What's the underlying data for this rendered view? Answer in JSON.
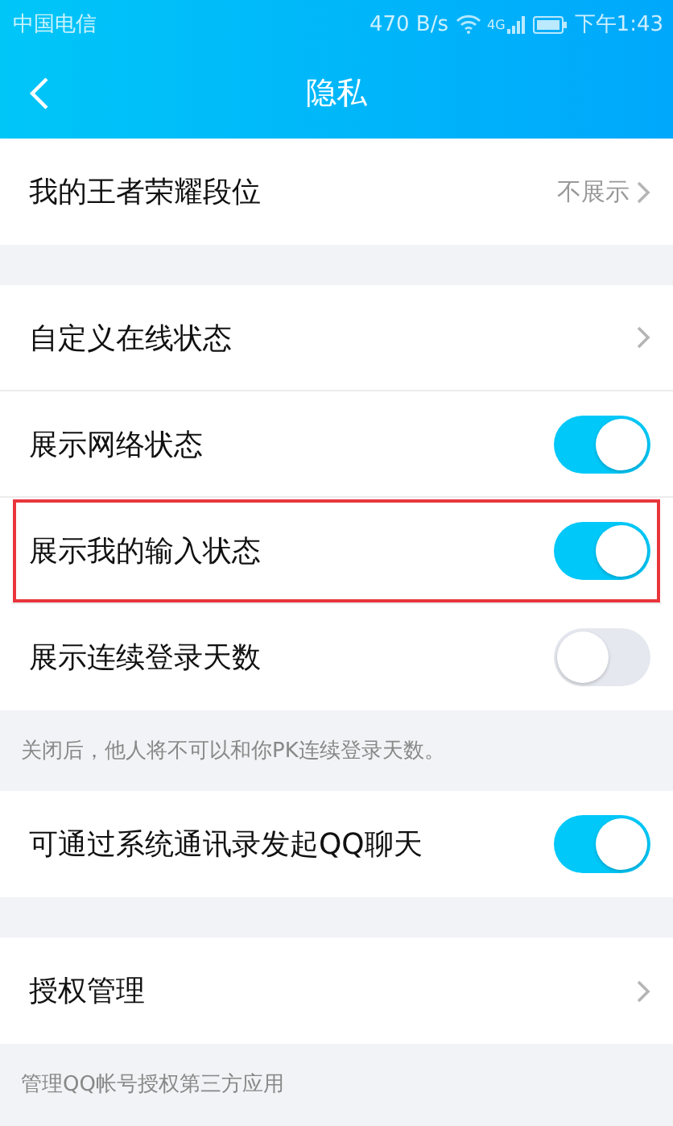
{
  "status_bar": {
    "carrier": "中国电信",
    "speed": "470 B/s",
    "network": "4G",
    "time": "下午1:43"
  },
  "nav": {
    "title": "隐私"
  },
  "sections": [
    {
      "rows": [
        {
          "kind": "link",
          "label": "我的王者荣耀段位",
          "value": "不展示",
          "highlighted": false
        }
      ]
    },
    {
      "rows": [
        {
          "kind": "link",
          "label": "自定义在线状态",
          "highlighted": false
        },
        {
          "kind": "toggle",
          "label": "展示网络状态",
          "on": true,
          "highlighted": false
        },
        {
          "kind": "toggle",
          "label": "展示我的输入状态",
          "on": true,
          "highlighted": true
        },
        {
          "kind": "toggle",
          "label": "展示连续登录天数",
          "on": false,
          "highlighted": false
        }
      ],
      "note": "关闭后，他人将不可以和你PK连续登录天数。"
    },
    {
      "rows": [
        {
          "kind": "toggle",
          "label": "可通过系统通讯录发起QQ聊天",
          "on": true,
          "highlighted": false
        }
      ]
    },
    {
      "rows": [
        {
          "kind": "link",
          "label": "授权管理",
          "highlighted": false
        }
      ],
      "note": "管理QQ帐号授权第三方应用"
    }
  ]
}
